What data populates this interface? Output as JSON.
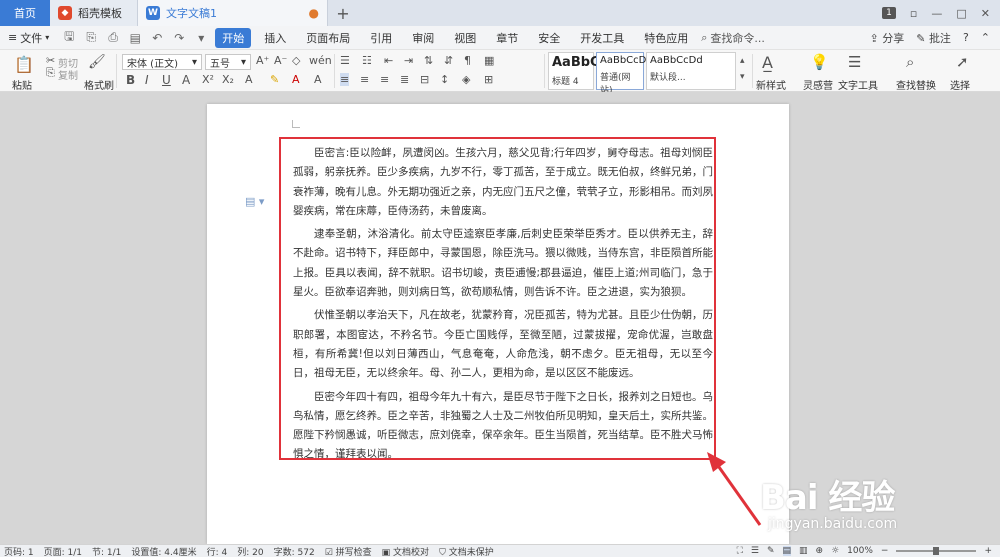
{
  "tabs": {
    "home": "首页",
    "templates": "稻壳模板",
    "document": "文字文稿1",
    "add": "+",
    "window_count": "1"
  },
  "menubar": {
    "file": "文件",
    "items": [
      "开始",
      "插入",
      "页面布局",
      "引用",
      "审阅",
      "视图",
      "章节",
      "安全",
      "开发工具",
      "特色应用"
    ],
    "search_placeholder": "查找命令...",
    "share": "分享",
    "comment": "批注",
    "more": "?"
  },
  "ribbon": {
    "paste": "粘贴",
    "cut": "剪切",
    "copy": "复制",
    "format_painter": "格式刷",
    "font_name": "宋体 (正文)",
    "font_size": "五号",
    "styles": [
      {
        "preview": "AaBbC",
        "caption": "标题 4"
      },
      {
        "preview": "AaBbCcD",
        "caption": "普通(网站)"
      },
      {
        "preview": "AaBbCcDd",
        "caption": "默认段..."
      }
    ],
    "new_style": "新样式",
    "inspiration": "灵感营",
    "text_tools": "文字工具",
    "find_replace": "查找替换",
    "select": "选择"
  },
  "document": {
    "paragraphs": [
      "臣密言:臣以险衅，夙遭闵凶。生孩六月，慈父见背;行年四岁，舅夺母志。祖母刘悯臣孤弱，躬亲抚养。臣少多疾病，九岁不行，零丁孤苦，至于成立。既无伯叔，终鲜兄弟，门衰祚薄，晚有儿息。外无期功强近之亲，内无应门五尺之僮，茕茕孑立，形影相吊。而刘夙婴疾病，常在床蓐，臣侍汤药，未曾废离。",
      "逮奉圣朝，沐浴清化。前太守臣逵察臣孝廉,后刺史臣荣举臣秀才。臣以供养无主，辞不赴命。诏书特下，拜臣郎中，寻蒙国恩，除臣洗马。猥以微贱，当侍东宫，非臣陨首所能上报。臣具以表闻，辞不就职。诏书切峻，责臣逋慢;郡县逼迫，催臣上道;州司临门，急于星火。臣欲奉诏奔驰，则刘病日笃，欲苟顺私情，则告诉不许。臣之进退，实为狼狈。",
      "伏惟圣朝以孝治天下，凡在故老，犹蒙矜育，况臣孤苦，特为尤甚。且臣少仕伪朝，历职郎署，本图宦达，不矜名节。今臣亡国贱俘，至微至陋，过蒙拔擢，宠命优渥，岂敢盘桓，有所希冀!但以刘日薄西山，气息奄奄，人命危浅，朝不虑夕。臣无祖母，无以至今日，祖母无臣，无以终余年。母、孙二人，更相为命，是以区区不能废远。",
      "臣密今年四十有四，祖母今年九十有六，是臣尽节于陛下之日长，报养刘之日短也。乌鸟私情，愿乞终养。臣之辛苦，非独蜀之人士及二州牧伯所见明知，皇天后土，实所共鉴。愿陛下矜悯愚诚，听臣微志，庶刘侥幸，保卒余年。臣生当陨首，死当结草。臣不胜犬马怖惧之情，谨拜表以闻。"
    ]
  },
  "statusbar": {
    "page_code": "页码: 1",
    "pages": "页面: 1/1",
    "section": "节: 1/1",
    "position": "设置值: 4.4厘米",
    "row": "行: 4",
    "column": "列: 20",
    "word_count": "字数: 572",
    "spellcheck": "拼写检查",
    "proofread": "文档校对",
    "protect": "文档未保护",
    "zoom": "100%"
  },
  "watermark": {
    "logo": "Bai 经验",
    "url": "jingyan.baidu.com"
  },
  "colors": {
    "accent": "#3a7bd5",
    "highlight_box": "#e0323a"
  }
}
